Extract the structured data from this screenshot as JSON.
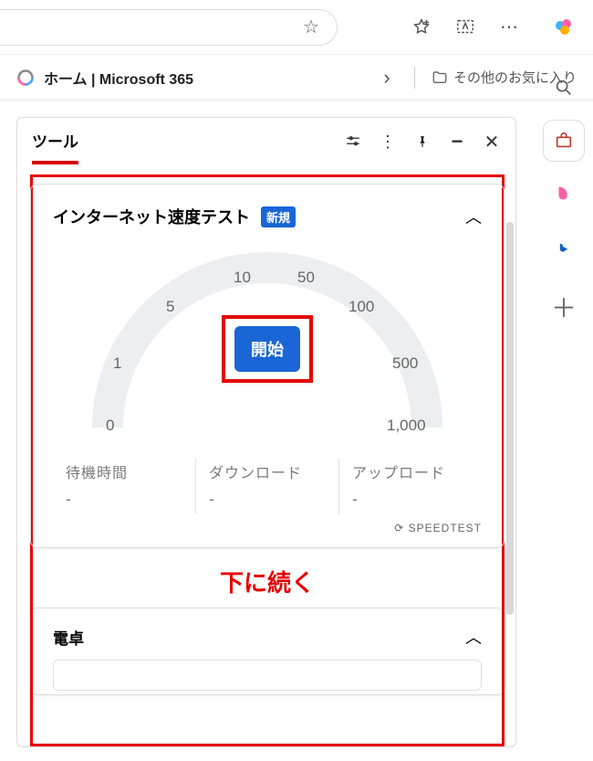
{
  "topbar": {
    "star_icon": "☆",
    "fav_icon": "fav-add",
    "screenshot_icon": "screenshot",
    "more_icon": "⋯"
  },
  "favbar": {
    "tab_title": "ホーム | Microsoft 365",
    "other_fav": "その他のお気に入り"
  },
  "panel": {
    "title": "ツール"
  },
  "speedtest": {
    "title": "インターネット速度テスト",
    "new_badge": "新規",
    "gauge_labels": [
      "0",
      "1",
      "5",
      "10",
      "50",
      "100",
      "500",
      "1,000"
    ],
    "start_label": "開始",
    "metrics": {
      "latency": {
        "label": "待機時間",
        "value": "-"
      },
      "download": {
        "label": "ダウンロード",
        "value": "-"
      },
      "upload": {
        "label": "アップロード",
        "value": "-"
      }
    },
    "brand": "⟳ SPEEDTEST"
  },
  "continue_text": "下に続く",
  "calculator": {
    "title": "電卓"
  },
  "colors": {
    "accent": "#1a66d6",
    "highlight": "#e40000"
  }
}
